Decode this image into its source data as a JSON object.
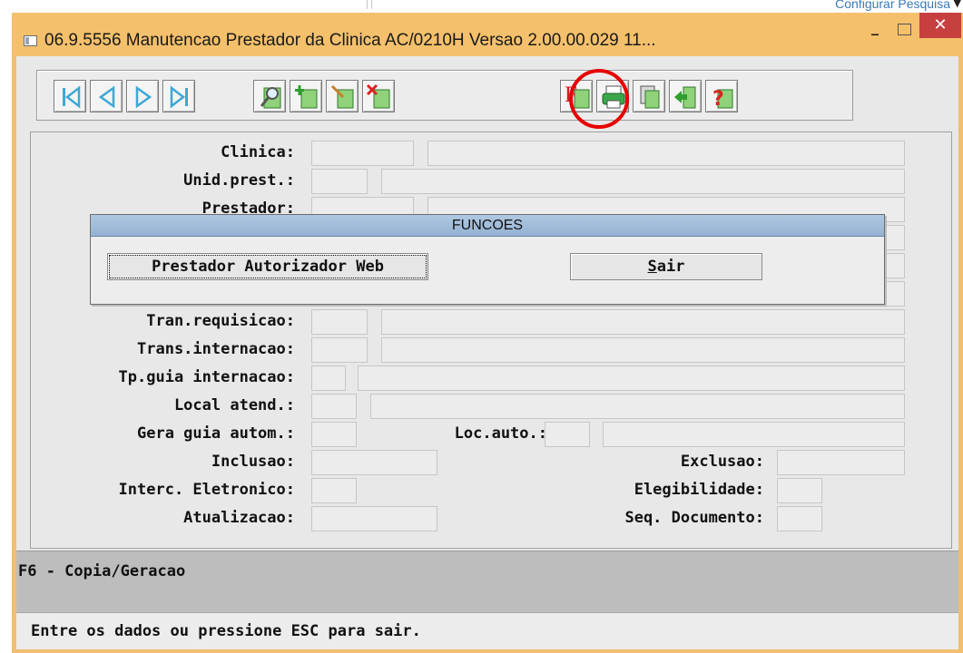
{
  "top": {
    "config_link": "Configurar Pesquisa",
    "caret": "▼"
  },
  "window": {
    "title": "06.9.5556 Manutencao  Prestador da Clinica AC/0210H Versao 2.00.00.029 11...",
    "min_glyph": "–",
    "close_glyph": "✕"
  },
  "toolbar": {
    "icons": [
      "first-icon",
      "prev-icon",
      "next-icon",
      "last-icon",
      "search-icon",
      "add-icon",
      "edit-icon",
      "delete-icon",
      "functions-icon",
      "print-icon",
      "copy-icon",
      "exit-icon",
      "help-icon"
    ],
    "functions_letter": "F",
    "help_glyph": "?"
  },
  "form": {
    "clinica": "Clinica:",
    "unid_prest": "Unid.prest.:",
    "prestador": "Prestador:",
    "tran_requisicao": "Tran.requisicao:",
    "trans_internacao": "Trans.internacao:",
    "tp_guia_internacao": "Tp.guia internacao:",
    "local_atend": "Local atend.:",
    "gera_guia_autom": "Gera guia autom.:",
    "loc_auto": "Loc.auto.:",
    "inclusao": "Inclusao:",
    "exclusao": "Exclusao:",
    "interc_eletronico": "Interc. Eletronico:",
    "elegibilidade": "Elegibilidade:",
    "atualizacao": "Atualizacao:",
    "seq_documento": "Seq. Documento:"
  },
  "status": {
    "line1": "F6 - Copia/Geracao",
    "line2": "Entre os dados ou pressione ESC para sair."
  },
  "dialog": {
    "title": "FUNCOES",
    "btn_prestador": "Prestador Autorizador Web",
    "btn_sair_first": "S",
    "btn_sair_rest": "air"
  },
  "colors": {
    "window_frame": "#f4c06b",
    "close": "#c73f3f",
    "dialog_title": "#a3bedb",
    "highlight_circle": "#e60000"
  }
}
